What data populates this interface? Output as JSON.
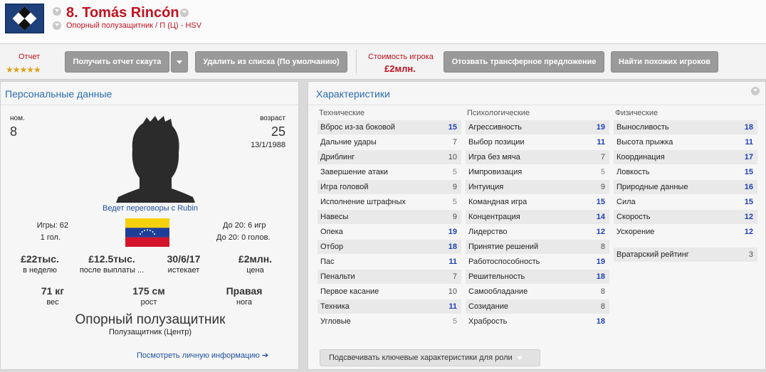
{
  "header": {
    "player_name": "8. Tomás Rincón",
    "position_club": "Опорный полузащитник / П (Ц) - HSV"
  },
  "toolbar": {
    "report_label": "Отчет",
    "stars": "★★★★★",
    "scout_button": "Получить отчет скаута",
    "remove_button": "Удалить из списка (По умолчанию)",
    "value_label": "Стоимость игрока",
    "value": "£2млн.",
    "withdraw_button": "Отозвать трансферное предложение",
    "similar_button": "Найти похожих игроков"
  },
  "personal": {
    "title": "Персональные данные",
    "number_label": "ном.",
    "number": "8",
    "age_label": "возраст",
    "age": "25",
    "birthdate": "13/1/1988",
    "negotiation": "Ведет переговоры с Rubin",
    "games": "Игры: 62",
    "goals": "1 гол.",
    "u20_games": "До 20: 6 игр",
    "u20_goals": "До 20: 0 голов.",
    "wage": "£22тыс.",
    "wage_label": "в неделю",
    "bonus": "£12.5тыс.",
    "bonus_label": "после выплаты ...",
    "expiry": "30/6/17",
    "expiry_label": "истекает",
    "price": "£2млн.",
    "price_label": "цена",
    "weight": "71 кг",
    "weight_label": "вес",
    "height": "175 см",
    "height_label": "рост",
    "foot": "Правая",
    "foot_label": "нога",
    "role": "Опорный полузащитник",
    "role_detail": "Полузащитник (Центр)",
    "more_link": "Посмотреть личную информацию"
  },
  "attributes": {
    "title": "Характеристики",
    "technical_title": "Технические",
    "mental_title": "Психологические",
    "physical_title": "Физические",
    "technical": [
      {
        "name": "Вброс из-за боковой",
        "value": "15"
      },
      {
        "name": "Дальние удары",
        "value": "7"
      },
      {
        "name": "Дриблинг",
        "value": "10"
      },
      {
        "name": "Завершение атаки",
        "value": "5"
      },
      {
        "name": "Игра головой",
        "value": "9"
      },
      {
        "name": "Исполнение штрафных",
        "value": "5"
      },
      {
        "name": "Навесы",
        "value": "9"
      },
      {
        "name": "Опека",
        "value": "19"
      },
      {
        "name": "Отбор",
        "value": "18"
      },
      {
        "name": "Пас",
        "value": "11"
      },
      {
        "name": "Пенальти",
        "value": "7"
      },
      {
        "name": "Первое касание",
        "value": "10"
      },
      {
        "name": "Техника",
        "value": "11"
      },
      {
        "name": "Угловые",
        "value": "5"
      }
    ],
    "mental": [
      {
        "name": "Агрессивность",
        "value": "19"
      },
      {
        "name": "Выбор позиции",
        "value": "11"
      },
      {
        "name": "Игра без мяча",
        "value": "7"
      },
      {
        "name": "Импровизация",
        "value": "5"
      },
      {
        "name": "Интуиция",
        "value": "9"
      },
      {
        "name": "Командная игра",
        "value": "15"
      },
      {
        "name": "Концентрация",
        "value": "14"
      },
      {
        "name": "Лидерство",
        "value": "12"
      },
      {
        "name": "Принятие решений",
        "value": "8"
      },
      {
        "name": "Работоспособность",
        "value": "19"
      },
      {
        "name": "Решительность",
        "value": "18"
      },
      {
        "name": "Самообладание",
        "value": "8"
      },
      {
        "name": "Созидание",
        "value": "8"
      },
      {
        "name": "Храбрость",
        "value": "18"
      }
    ],
    "physical": [
      {
        "name": "Выносливость",
        "value": "18"
      },
      {
        "name": "Высота прыжка",
        "value": "11"
      },
      {
        "name": "Координация",
        "value": "17"
      },
      {
        "name": "Ловкость",
        "value": "15"
      },
      {
        "name": "Природные данные",
        "value": "16"
      },
      {
        "name": "Сила",
        "value": "15"
      },
      {
        "name": "Скорость",
        "value": "12"
      },
      {
        "name": "Ускорение",
        "value": "12"
      }
    ],
    "gk_rating_label": "Вратарский рейтинг",
    "gk_rating": "3",
    "role_button": "Подсвечивать ключевые характеристики для роли"
  }
}
